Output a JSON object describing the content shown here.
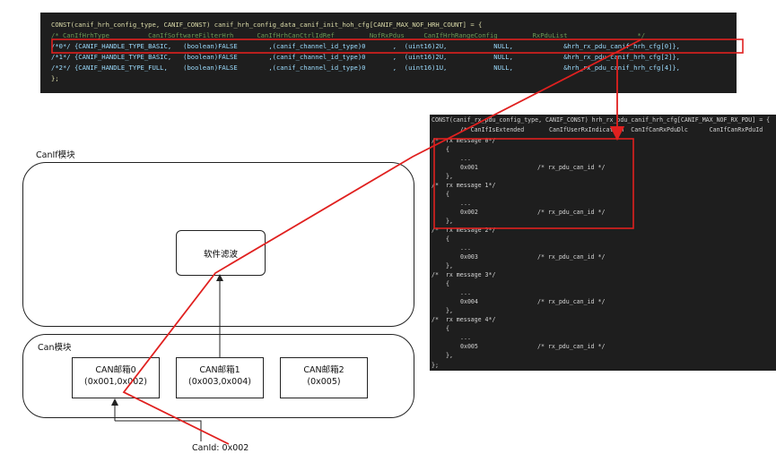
{
  "top_code": {
    "line1": "CONST(canif_hrh_config_type, CANIF_CONST) canif_hrh_config_data_canif_init_hoh_cfg[CANIF_MAX_NOF_HRH_COUNT] = {",
    "header": "/* CanIfHrhType          CanIfSoftwareFilterHrh      CanIfHrhCanCtrlIdRef         NofRxPdus     CanIfHrhRangeConfig         RxPduList                  */",
    "row0": "/*0*/ {CANIF_HANDLE_TYPE_BASIC,   (boolean)FALSE        ,(canif_channel_id_type)0       ,  (uint16)2U,            NULL,             &hrh_rx_pdu_canif_hrh_cfg[0]},",
    "row1": "/*1*/ {CANIF_HANDLE_TYPE_BASIC,   (boolean)FALSE        ,(canif_channel_id_type)0       ,  (uint16)2U,            NULL,             &hrh_rx_pdu_canif_hrh_cfg[2]},",
    "row2": "/*2*/ {CANIF_HANDLE_TYPE_FULL,    (boolean)FALSE        ,(canif_channel_id_type)0       ,  (uint16)1U,            NULL,             &hrh_rx_pdu_canif_hrh_cfg[4]},",
    "end": "};"
  },
  "right_code": {
    "line1": "CONST(canif_rx_pdu_config_type, CANIF_CONST) hrh_rx_pdu_canif_hrh_cfg[CANIF_MAX_NOF_RX_PDU] = {",
    "header": "        /* CanIfIsExtended       CanIfUserRxIndication  CanIfCanRxPduDlc      CanIfCanRxPduId",
    "messages": [
      {
        "comment": "/*  rx message 0*/",
        "id": "0x001",
        "id_comment": "/* rx_pdu_can_id */"
      },
      {
        "comment": "/*  rx message 1*/",
        "id": "0x002",
        "id_comment": "/* rx_pdu_can_id */"
      },
      {
        "comment": "/*  rx message 2*/",
        "id": "0x003",
        "id_comment": "/* rx_pdu_can_id */"
      },
      {
        "comment": "/*  rx message 3*/",
        "id": "0x004",
        "id_comment": "/* rx_pdu_can_id */"
      },
      {
        "comment": "/*  rx message 4*/",
        "id": "0x005",
        "id_comment": "/* rx_pdu_can_id */"
      }
    ],
    "open_brace": "{",
    "ellipsis": "...",
    "close_brace": "},",
    "end": "};"
  },
  "diagram": {
    "canif_module_label": "CanIf模块",
    "software_filter_label": "软件滤波",
    "can_module_label": "Can模块",
    "mailboxes": [
      {
        "name": "CAN邮箱0",
        "ids": "(0x001,0x002)"
      },
      {
        "name": "CAN邮箱1",
        "ids": "(0x003,0x004)"
      },
      {
        "name": "CAN邮箱2",
        "ids": "(0x005)"
      }
    ],
    "can_id_label": "CanId: 0x002"
  },
  "colors": {
    "highlight": "#e0201f",
    "code_bg": "#1e1e1e"
  }
}
